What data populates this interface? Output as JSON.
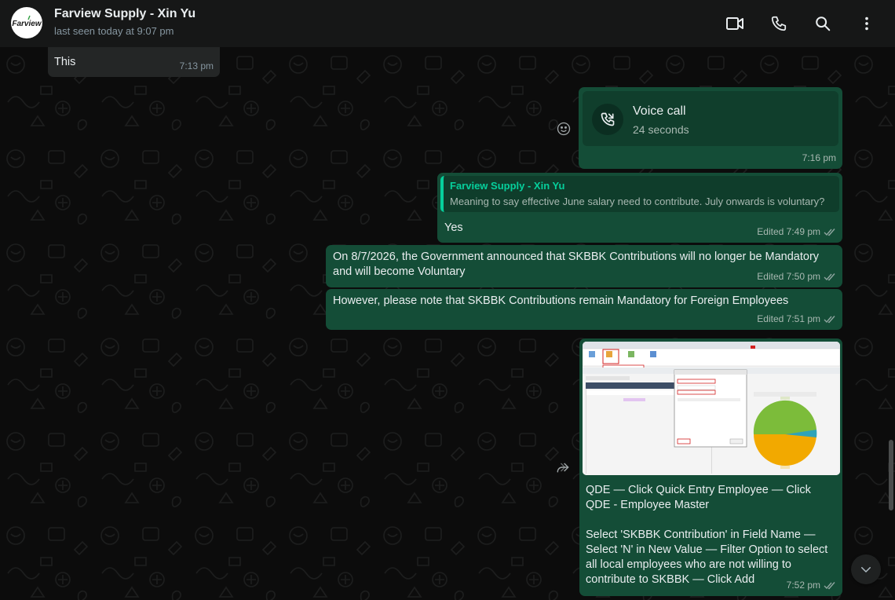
{
  "header": {
    "logo_text": "Farview",
    "contact_name": "Farview Supply - Xin Yu",
    "status": "last seen today at 9:07 pm",
    "icons": [
      "video-call-icon",
      "phone-icon",
      "search-icon",
      "menu-icon"
    ]
  },
  "messages": [
    {
      "type": "in",
      "text": "This",
      "time": "7:13 pm"
    },
    {
      "type": "call",
      "title": "Voice call",
      "duration": "24 seconds",
      "time": "7:16 pm"
    },
    {
      "type": "reply",
      "quote_author": "Farview Supply - Xin Yu",
      "quote_text": "Meaning to say effective June salary need to contribute. July onwards is voluntary?",
      "text": "Yes",
      "time": "Edited 7:49 pm"
    },
    {
      "type": "out",
      "text": "On 8/7/2026, the Government announced that SKBBK Contributions will no longer be Mandatory and will become Voluntary",
      "time": "Edited 7:50 pm"
    },
    {
      "type": "out",
      "text": "However, please note that SKBBK Contributions remain Mandatory for Foreign Employees",
      "time": "Edited 7:51 pm"
    },
    {
      "type": "image",
      "caption_1": "QDE — Click Quick Entry Employee — Click QDE - Employee Master",
      "caption_2": "Select 'SKBBK Contribution' in Field Name — Select 'N' in New Value — Filter Option to select all local employees who are not willing to contribute to SKBBK — Click Add",
      "time": "7:52 pm"
    }
  ],
  "colors": {
    "header_bg": "#161717",
    "chat_bg": "#0c0c0c",
    "incoming_bubble": "#242626",
    "outgoing_bubble": "#144d37",
    "accent": "#06cf9c"
  }
}
